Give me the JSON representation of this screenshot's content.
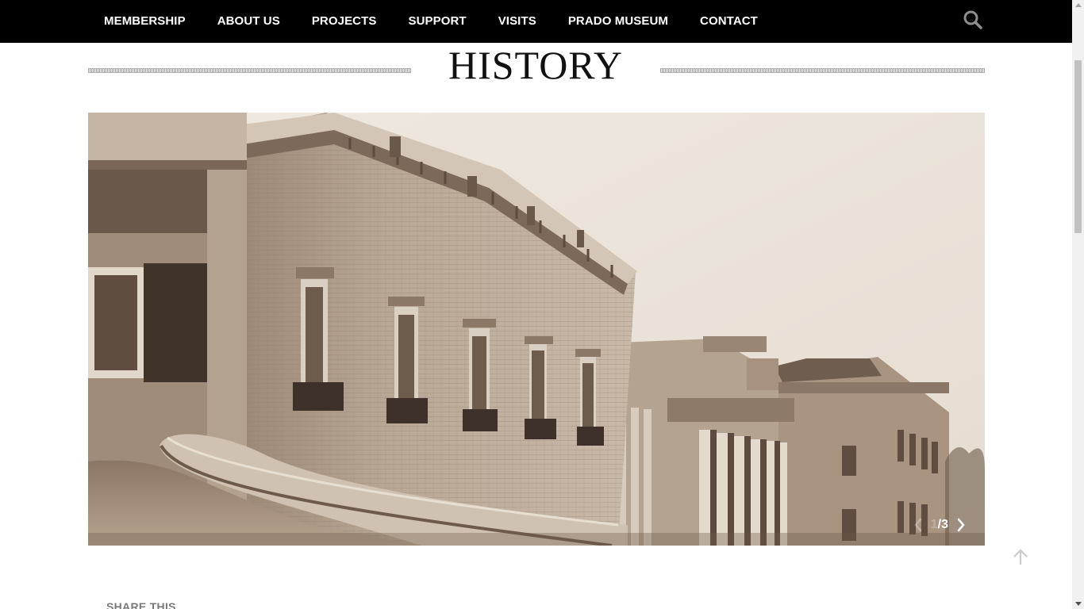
{
  "nav": {
    "items": [
      {
        "label": "MEMBERSHIP"
      },
      {
        "label": "ABOUT US"
      },
      {
        "label": "PROJECTS"
      },
      {
        "label": "SUPPORT"
      },
      {
        "label": "VISITS"
      },
      {
        "label": "PRADO MUSEUM"
      },
      {
        "label": "CONTACT"
      }
    ],
    "search_icon": "search-icon"
  },
  "page": {
    "title": "HISTORY"
  },
  "slider": {
    "current": "1",
    "separator": "/",
    "total": "3",
    "prev_icon": "chevron-left-icon",
    "next_icon": "chevron-right-icon"
  },
  "back_to_top_icon": "arrow-up-icon",
  "share": {
    "label": "SHARE THIS"
  },
  "colors": {
    "nav_bg": "#000000",
    "nav_text": "#ffffff",
    "title": "#111111",
    "sepia_light": "#ebe5dc",
    "sepia_dark": "#5a4a3c"
  }
}
